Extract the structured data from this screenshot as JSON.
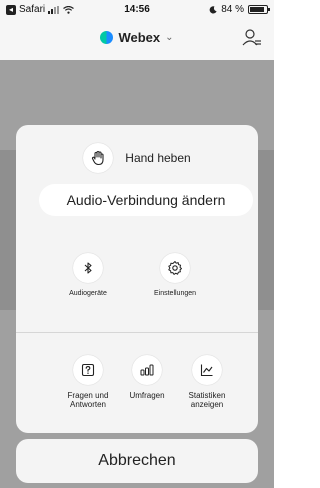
{
  "status_bar": {
    "carrier": "Safari",
    "signal_icon": "signal-icon",
    "wifi_icon": "wifi-icon",
    "time": "14:56",
    "battery_percent": "84 %",
    "moon_icon": "moon-icon"
  },
  "header": {
    "app_title": "Webex",
    "logo_icon": "webex-logo-icon",
    "participants_icon": "participants-icon"
  },
  "sheet": {
    "raise_hand_label": "Hand heben",
    "raise_hand_icon": "hand-icon",
    "audio_change_label": "Audio-Verbindung ändern",
    "audio_devices_label": "Audiogeräte",
    "audio_devices_icon": "bluetooth-icon",
    "settings_label": "Einstellungen",
    "settings_icon": "gear-icon",
    "qa_label": "Fragen und Antworten",
    "qa_icon": "question-icon",
    "polls_label": "Umfragen",
    "polls_icon": "bar-chart-icon",
    "stats_label": "Statistiken anzeigen",
    "stats_icon": "line-chart-icon"
  },
  "cancel_label": "Abbrechen"
}
